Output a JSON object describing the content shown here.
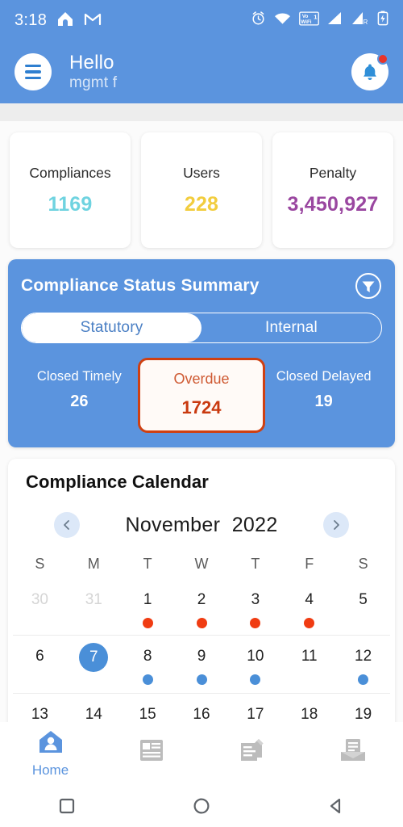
{
  "statusbar": {
    "time": "3:18",
    "icons_left": [
      "home-icon",
      "gmail-icon"
    ],
    "icons_right": [
      "alarm-icon",
      "wifi-icon",
      "vowifi-icon",
      "signal-1-icon",
      "signal-2-roaming-icon",
      "battery-charging-icon"
    ],
    "vowifi_label_top": "Vo",
    "vowifi_label_bottom": "WiFi",
    "vowifi_sim": "1",
    "roaming_label": "R"
  },
  "header": {
    "menu_icon": "hamburger-icon",
    "greeting": "Hello",
    "username": "mgmt f",
    "bell_icon": "bell-icon",
    "has_notification": true,
    "background_color": "#5b94de"
  },
  "stats": [
    {
      "label": "Compliances",
      "value": "1169",
      "color": "#6fd3e0"
    },
    {
      "label": "Users",
      "value": "228",
      "color": "#f2cd3e"
    },
    {
      "label": "Penalty",
      "value": "3,450,927",
      "color": "#9a47a0"
    }
  ],
  "summary": {
    "title": "Compliance Status Summary",
    "filter_icon": "filter-funnel-icon",
    "tabs": [
      {
        "label": "Statutory",
        "active": true
      },
      {
        "label": "Internal",
        "active": false
      }
    ],
    "metrics": [
      {
        "label": "Closed Timely",
        "value": "26",
        "highlight": false
      },
      {
        "label": "Overdue",
        "value": "1724",
        "highlight": true
      },
      {
        "label": "Closed Delayed",
        "value": "19",
        "highlight": false
      }
    ],
    "accent_color": "#cf4012"
  },
  "calendar": {
    "title": "Compliance Calendar",
    "prev_icon": "chevron-left-icon",
    "next_icon": "chevron-right-icon",
    "month": "November",
    "year": "2022",
    "weekdays": [
      "S",
      "M",
      "T",
      "W",
      "T",
      "F",
      "S"
    ],
    "weeks": [
      [
        {
          "day": "30",
          "muted": true,
          "today": false,
          "dot": "none"
        },
        {
          "day": "31",
          "muted": true,
          "today": false,
          "dot": "none"
        },
        {
          "day": "1",
          "muted": false,
          "today": false,
          "dot": "red"
        },
        {
          "day": "2",
          "muted": false,
          "today": false,
          "dot": "red"
        },
        {
          "day": "3",
          "muted": false,
          "today": false,
          "dot": "red"
        },
        {
          "day": "4",
          "muted": false,
          "today": false,
          "dot": "red"
        },
        {
          "day": "5",
          "muted": false,
          "today": false,
          "dot": "none"
        }
      ],
      [
        {
          "day": "6",
          "muted": false,
          "today": false,
          "dot": "none"
        },
        {
          "day": "7",
          "muted": false,
          "today": true,
          "dot": "none"
        },
        {
          "day": "8",
          "muted": false,
          "today": false,
          "dot": "blue"
        },
        {
          "day": "9",
          "muted": false,
          "today": false,
          "dot": "blue"
        },
        {
          "day": "10",
          "muted": false,
          "today": false,
          "dot": "blue"
        },
        {
          "day": "11",
          "muted": false,
          "today": false,
          "dot": "none"
        },
        {
          "day": "12",
          "muted": false,
          "today": false,
          "dot": "blue"
        }
      ],
      [
        {
          "day": "13",
          "muted": false,
          "today": false,
          "dot": "none"
        },
        {
          "day": "14",
          "muted": false,
          "today": false,
          "dot": "none"
        },
        {
          "day": "15",
          "muted": false,
          "today": false,
          "dot": "none"
        },
        {
          "day": "16",
          "muted": false,
          "today": false,
          "dot": "none"
        },
        {
          "day": "17",
          "muted": false,
          "today": false,
          "dot": "none"
        },
        {
          "day": "18",
          "muted": false,
          "today": false,
          "dot": "none"
        },
        {
          "day": "19",
          "muted": false,
          "today": false,
          "dot": "none"
        }
      ]
    ],
    "today_color": "#4a8fd8",
    "overdue_dot_color": "#f03c12",
    "upcoming_dot_color": "#4a8fd8"
  },
  "bottomnav": {
    "items": [
      {
        "label": "Home",
        "icon": "home-person-icon",
        "active": true
      },
      {
        "label": "",
        "icon": "news-document-icon",
        "active": false
      },
      {
        "label": "",
        "icon": "edit-note-icon",
        "active": false
      },
      {
        "label": "",
        "icon": "inbox-tray-icon",
        "active": false
      }
    ],
    "active_color": "#5b94de",
    "inactive_color": "#bcbcbc"
  },
  "sysnav": {
    "buttons": [
      {
        "icon": "recents-square-icon"
      },
      {
        "icon": "home-circle-icon"
      },
      {
        "icon": "back-triangle-icon"
      }
    ]
  }
}
